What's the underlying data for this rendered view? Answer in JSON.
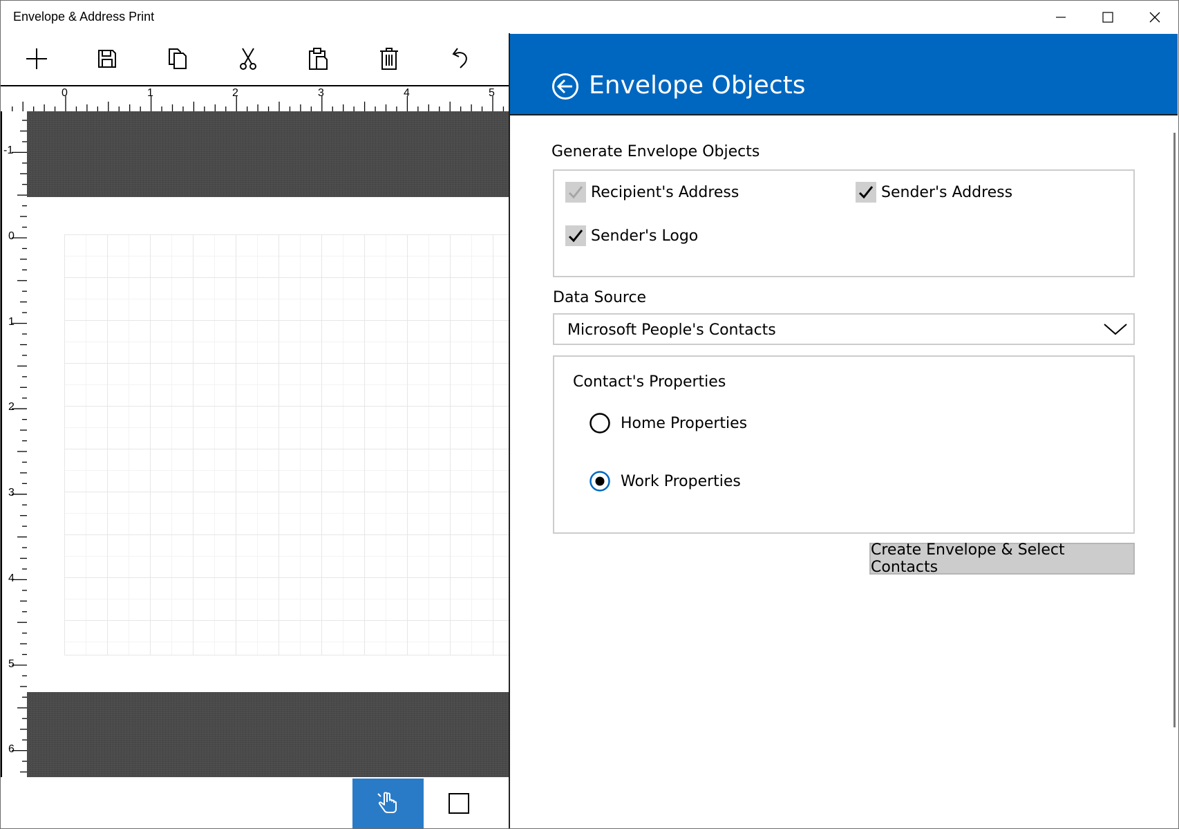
{
  "window": {
    "title": "Envelope & Address Print"
  },
  "toolbar": {
    "items": [
      "new-icon",
      "save-icon",
      "copy-icon",
      "cut-icon",
      "paste-icon",
      "delete-icon",
      "undo-icon"
    ]
  },
  "ruler": {
    "top_labels": [
      "0",
      "1",
      "2",
      "3",
      "4",
      "5"
    ],
    "left_labels": [
      "-1",
      "0",
      "1",
      "2",
      "3",
      "4",
      "5",
      "6"
    ]
  },
  "panel": {
    "title": "Envelope Objects",
    "generate_heading": "Generate Envelope Objects",
    "checkboxes": [
      {
        "label": "Recipient's Address",
        "checked": true,
        "disabled": true
      },
      {
        "label": "Sender's Address",
        "checked": true,
        "disabled": false
      },
      {
        "label": "Sender's Logo",
        "checked": true,
        "disabled": false
      }
    ],
    "data_source_label": "Data Source",
    "data_source_value": "Microsoft People's Contacts",
    "contact_properties_heading": "Contact's Properties",
    "radio_options": [
      {
        "label": "Home Properties",
        "selected": false
      },
      {
        "label": "Work Properties",
        "selected": true
      }
    ],
    "create_button": "Create Envelope & Select Contacts"
  },
  "colors": {
    "accent": "#0067c0",
    "tool_active": "#2a7bc7"
  }
}
